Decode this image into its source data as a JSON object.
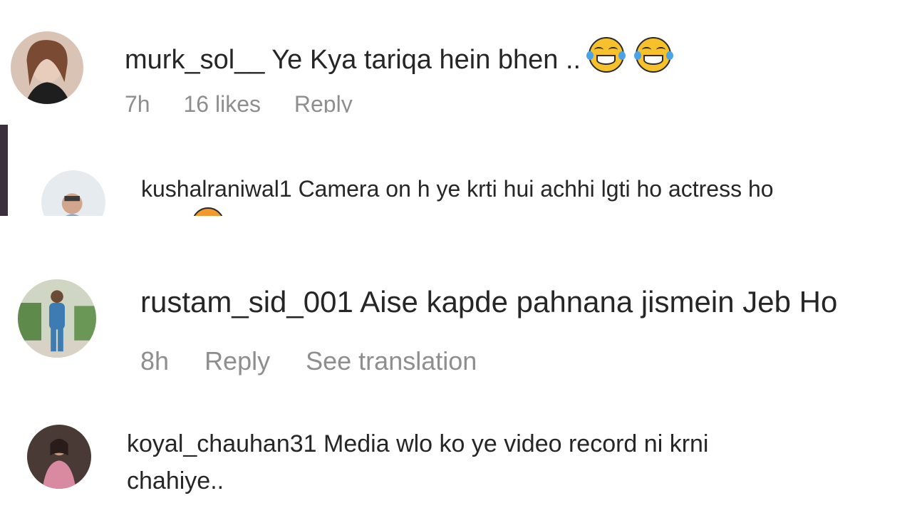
{
  "comments": [
    {
      "username": "murk_sol__",
      "text": "Ye Kya tariqa hein bhen ..",
      "emojis": [
        "face-with-tears-of-joy",
        "face-with-tears-of-joy"
      ],
      "time": "7h",
      "likes": "16 likes",
      "reply": "Reply"
    },
    {
      "username": "kushalraniwal1",
      "text": "Camera on h ye krti hui achhi lgti ho actress ho"
    },
    {
      "username": "rustam_sid_001",
      "text": "Aise kapde pahnana jismein Jeb Ho",
      "time": "8h",
      "reply": "Reply",
      "translation": "See translation"
    },
    {
      "username": "koyal_chauhan31",
      "text_line1": "Media wlo ko ye video record ni krni",
      "text_line2": "chahiye.."
    }
  ],
  "colors": {
    "text": "#262626",
    "meta": "#8e8e8e",
    "accent_bar": "#3b2f3d",
    "emoji_face": "#f7c12b",
    "emoji_tear": "#4aa3e8"
  }
}
